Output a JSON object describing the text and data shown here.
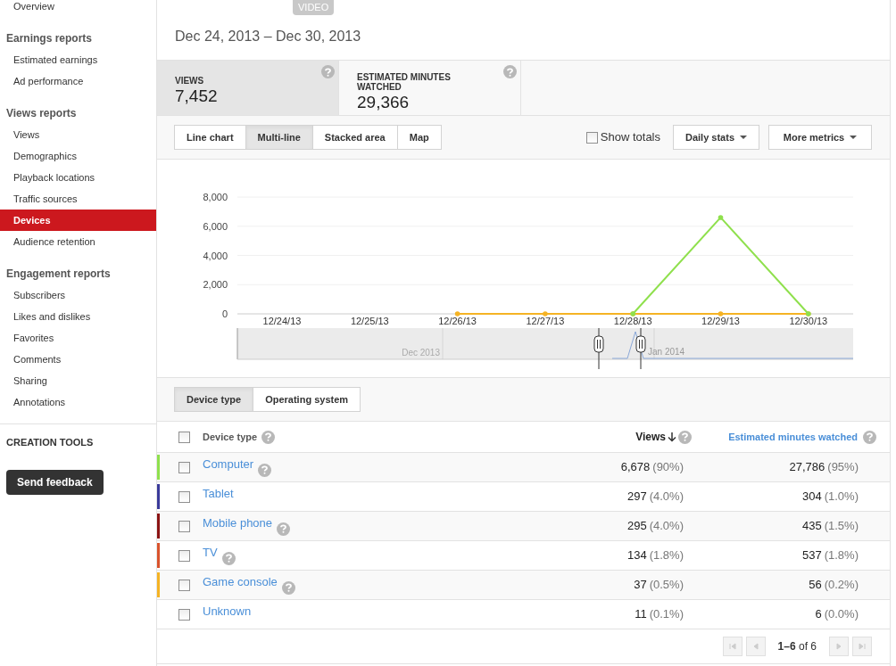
{
  "sidebar": {
    "sections": [
      {
        "items": [
          {
            "label": "Overview",
            "selected": false
          }
        ]
      },
      {
        "title": "Earnings reports",
        "items": [
          {
            "label": "Estimated earnings",
            "selected": false
          },
          {
            "label": "Ad performance",
            "selected": false
          }
        ]
      },
      {
        "title": "Views reports",
        "items": [
          {
            "label": "Views",
            "selected": false
          },
          {
            "label": "Demographics",
            "selected": false
          },
          {
            "label": "Playback locations",
            "selected": false
          },
          {
            "label": "Traffic sources",
            "selected": false
          },
          {
            "label": "Devices",
            "selected": true
          },
          {
            "label": "Audience retention",
            "selected": false
          }
        ]
      },
      {
        "title": "Engagement reports",
        "items": [
          {
            "label": "Subscribers",
            "selected": false
          },
          {
            "label": "Likes and dislikes",
            "selected": false
          },
          {
            "label": "Favorites",
            "selected": false
          },
          {
            "label": "Comments",
            "selected": false
          },
          {
            "label": "Sharing",
            "selected": false
          },
          {
            "label": "Annotations",
            "selected": false
          }
        ]
      }
    ],
    "creation_tools": "CREATION TOOLS",
    "feedback_button": "Send feedback"
  },
  "header": {
    "badge": "VIDEO",
    "date_range": "Dec 24, 2013 – Dec 30, 2013"
  },
  "metrics": [
    {
      "label": "VIEWS",
      "value": "7,452",
      "selected": true
    },
    {
      "label": "ESTIMATED MINUTES WATCHED",
      "value": "29,366",
      "selected": false
    }
  ],
  "chart_types": [
    {
      "label": "Line chart",
      "selected": false
    },
    {
      "label": "Multi-line",
      "selected": true
    },
    {
      "label": "Stacked area",
      "selected": false
    },
    {
      "label": "Map",
      "selected": false
    }
  ],
  "show_totals": {
    "label": "Show totals",
    "checked": false
  },
  "dropdowns": [
    "Daily stats",
    "More metrics"
  ],
  "chart": {
    "chart_data": {
      "type": "line",
      "grid": true,
      "categories": [
        "12/24/13",
        "12/25/13",
        "12/26/13",
        "12/27/13",
        "12/28/13",
        "12/29/13",
        "12/30/13"
      ],
      "ylim": [
        0,
        8000
      ],
      "yticks": [
        0,
        {
          "value": 2000,
          "label": "2,000"
        },
        {
          "value": 4000,
          "label": "4,000"
        },
        {
          "value": 6000,
          "label": "6,000"
        },
        {
          "value": 8000,
          "label": "8,000"
        }
      ],
      "series": [
        {
          "color": "#f5b324",
          "values": [
            null,
            null,
            0,
            0,
            0,
            0,
            0
          ]
        },
        {
          "color": "#8fe04d",
          "values": [
            null,
            null,
            null,
            null,
            0,
            6600,
            0
          ]
        }
      ]
    },
    "navigator_labels": [
      "Dec 2013",
      "Jan 2014"
    ]
  },
  "breakdown_tabs": [
    {
      "label": "Device type",
      "selected": true
    },
    {
      "label": "Operating system",
      "selected": false
    }
  ],
  "table": {
    "select_all": {
      "checked": false
    },
    "columns": [
      "Device type",
      "Views",
      "Estimated minutes watched"
    ],
    "rows": [
      {
        "name": "Computer",
        "help": true,
        "color": "#8fe04d",
        "checked": false,
        "views": "6,678",
        "views_share": "(90%)",
        "minutes": "27,786",
        "minutes_share": "(95%)"
      },
      {
        "name": "Tablet",
        "help": false,
        "color": "#3a3a9a",
        "checked": false,
        "views": "297",
        "views_share": "(4.0%)",
        "minutes": "304",
        "minutes_share": "(1.0%)"
      },
      {
        "name": "Mobile phone",
        "help": true,
        "color": "#8b1414",
        "checked": false,
        "views": "295",
        "views_share": "(4.0%)",
        "minutes": "435",
        "minutes_share": "(1.5%)"
      },
      {
        "name": "TV",
        "help": true,
        "color": "#d9532c",
        "checked": false,
        "views": "134",
        "views_share": "(1.8%)",
        "minutes": "537",
        "minutes_share": "(1.8%)"
      },
      {
        "name": "Game console",
        "help": true,
        "color": "#f5b324",
        "checked": false,
        "views": "37",
        "views_share": "(0.5%)",
        "minutes": "56",
        "minutes_share": "(0.2%)"
      },
      {
        "name": "Unknown",
        "help": false,
        "checked": false,
        "views": "11",
        "views_share": "(0.1%)",
        "minutes": "6",
        "minutes_share": "(0.0%)"
      }
    ]
  },
  "pagination": {
    "range": "**1–6** of 6"
  }
}
